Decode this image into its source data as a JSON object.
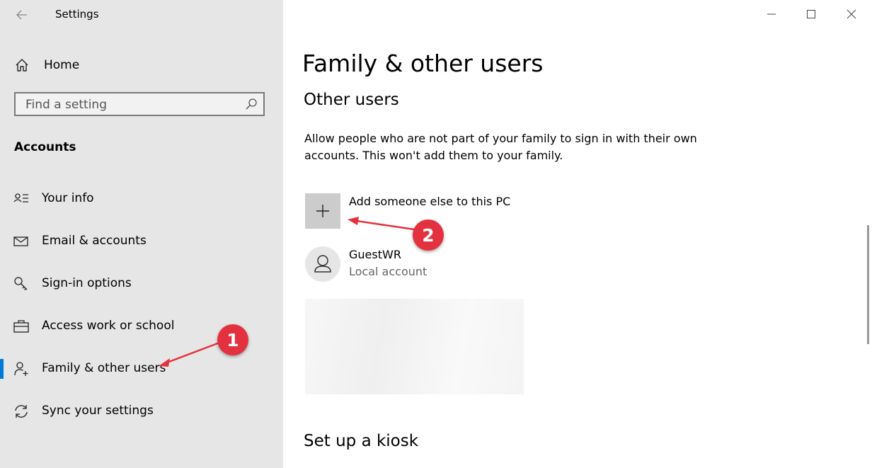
{
  "window": {
    "app_title": "Settings",
    "icons": {
      "back": "back-arrow-icon",
      "minimize": "minimize-icon",
      "maximize": "maximize-icon",
      "close": "close-icon"
    }
  },
  "sidebar": {
    "home_label": "Home",
    "search": {
      "placeholder": "Find a setting",
      "value": ""
    },
    "section_heading": "Accounts",
    "items": [
      {
        "label": "Your info",
        "icon": "person-card-icon",
        "active": false
      },
      {
        "label": "Email & accounts",
        "icon": "mail-icon",
        "active": false
      },
      {
        "label": "Sign-in options",
        "icon": "key-icon",
        "active": false
      },
      {
        "label": "Access work or school",
        "icon": "briefcase-icon",
        "active": false
      },
      {
        "label": "Family & other users",
        "icon": "person-add-icon",
        "active": true
      },
      {
        "label": "Sync your settings",
        "icon": "sync-icon",
        "active": false
      }
    ]
  },
  "main": {
    "page_title": "Family & other users",
    "section_title": "Other users",
    "description": "Allow people who are not part of your family to sign in with their own accounts. This won't add them to your family.",
    "add_label": "Add someone else to this PC",
    "users": [
      {
        "name": "GuestWR",
        "type": "Local account"
      }
    ],
    "kiosk_title": "Set up a kiosk"
  },
  "annotations": {
    "badge_1": "1",
    "badge_2": "2",
    "color": "#e4313f"
  },
  "colors": {
    "accent": "#0078d7",
    "sidebar_bg": "#e6e6e6"
  }
}
